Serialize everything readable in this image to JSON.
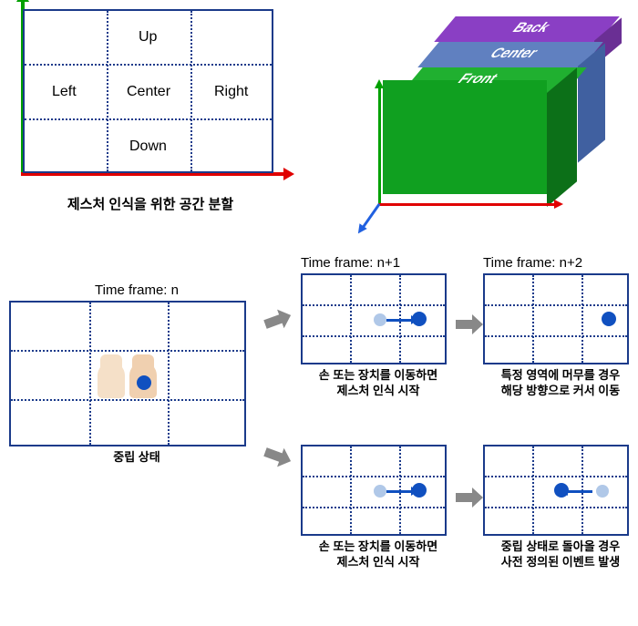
{
  "grid2d": {
    "up": "Up",
    "down": "Down",
    "left": "Left",
    "right": "Right",
    "center": "Center",
    "caption": "제스처 인식을 위한 공간 분할"
  },
  "box3d": {
    "front": "Front",
    "center": "Center",
    "back": "Back"
  },
  "flow": {
    "frame_n": "Time frame: n",
    "frame_n1": "Time frame: n+1",
    "frame_n2": "Time frame: n+2",
    "neutral_caption": "중립 상태",
    "move_caption_l1": "손 또는 장치를 이동하면",
    "move_caption_l2": "제스처 인식 시작",
    "stay_caption_l1": "특정 영역에 머무를 경우",
    "stay_caption_l2": "해당 방향으로 커서 이동",
    "return_caption_l1": "중립 상태로 돌아올 경우",
    "return_caption_l2": "사전 정의된 이벤트 발생"
  }
}
